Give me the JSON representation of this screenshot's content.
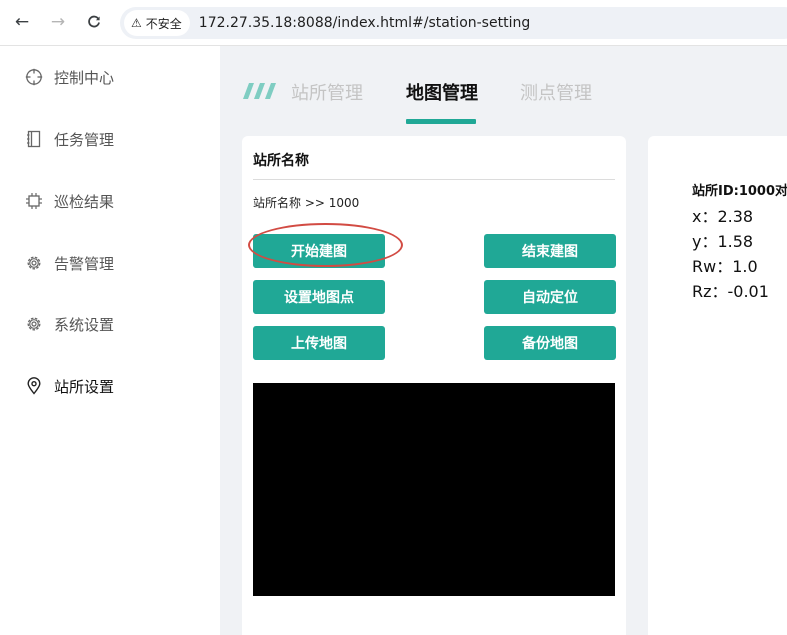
{
  "browser": {
    "security_label": "不安全",
    "url": "172.27.35.18:8088/index.html#/station-setting"
  },
  "sidebar": {
    "items": [
      {
        "label": "控制中心",
        "icon": "crosshair-icon"
      },
      {
        "label": "任务管理",
        "icon": "notebook-icon"
      },
      {
        "label": "巡检结果",
        "icon": "chip-icon"
      },
      {
        "label": "告警管理",
        "icon": "gear-icon"
      },
      {
        "label": "系统设置",
        "icon": "gear-icon"
      },
      {
        "label": "站所设置",
        "icon": "location-pin-icon",
        "active": true
      }
    ]
  },
  "tabs": [
    {
      "label": "站所管理"
    },
    {
      "label": "地图管理",
      "active": true
    },
    {
      "label": "测点管理"
    }
  ],
  "station_panel": {
    "title": "站所名称",
    "breadcrumb": "站所名称 >> 1000",
    "buttons": {
      "start_mapping": "开始建图",
      "end_mapping": "结束建图",
      "set_map_point": "设置地图点",
      "auto_locate": "自动定位",
      "upload_map": "上传地图",
      "backup_map": "备份地图"
    }
  },
  "pose_panel": {
    "title": "站所ID:1000对",
    "x": "x：2.38",
    "y": "y：1.58",
    "rw": "Rw：1.0",
    "rz": "Rz：-0.01"
  },
  "colors": {
    "accent": "#20a896",
    "highlight": "#d24b43",
    "map_background": "#000000"
  }
}
